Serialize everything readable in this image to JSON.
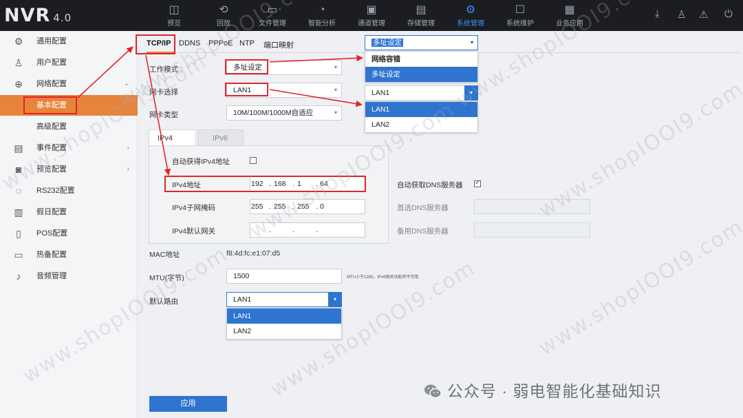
{
  "app": {
    "logo": "NVR",
    "version": "4.0"
  },
  "nav": [
    {
      "label": "预览",
      "icon": "preview-icon"
    },
    {
      "label": "回放",
      "icon": "playback-icon"
    },
    {
      "label": "文件管理",
      "icon": "folder-icon"
    },
    {
      "label": "智能分析",
      "icon": "analysis-icon"
    },
    {
      "label": "通道管理",
      "icon": "channel-icon"
    },
    {
      "label": "存储管理",
      "icon": "storage-icon"
    },
    {
      "label": "系统管理",
      "icon": "gear-icon",
      "active": true
    },
    {
      "label": "系统维护",
      "icon": "maintenance-icon"
    },
    {
      "label": "业务应用",
      "icon": "apps-icon"
    }
  ],
  "sidebar": {
    "items": [
      {
        "label": "通用配置",
        "icon": "gear-icon"
      },
      {
        "label": "用户配置",
        "icon": "user-icon"
      },
      {
        "label": "网络配置",
        "icon": "globe-icon",
        "arrow": "⌄"
      },
      {
        "label": "基本配置",
        "active": true
      },
      {
        "label": "高级配置"
      },
      {
        "label": "事件配置",
        "icon": "event-icon",
        "arrow": "›"
      },
      {
        "label": "预览配置",
        "icon": "camera-icon",
        "arrow": "›"
      },
      {
        "label": "RS232配置",
        "icon": "serial-icon"
      },
      {
        "label": "假日配置",
        "icon": "calendar-icon"
      },
      {
        "label": "POS配置",
        "icon": "pos-icon"
      },
      {
        "label": "热备配置",
        "icon": "hotspare-icon"
      },
      {
        "label": "音频管理",
        "icon": "audio-icon"
      }
    ]
  },
  "tabs": [
    "TCP/IP",
    "DDNS",
    "PPPoE",
    "NTP",
    "端口映射"
  ],
  "form": {
    "work_mode_label": "工作模式",
    "work_mode_value": "多址设定",
    "nic_label": "网卡选择",
    "nic_value": "LAN1",
    "nic_type_label": "网卡类型",
    "nic_type_value": "10M/100M/1000M自适应",
    "subtabs": [
      "IPv4",
      "IPv6"
    ],
    "auto_ipv4_label": "自动获得IPv4地址",
    "ipv4_addr_label": "IPv4地址",
    "ipv4_addr": [
      "192",
      "168",
      "1",
      "64"
    ],
    "ipv4_mask_label": "IPv4子网掩码",
    "ipv4_mask": [
      "255",
      "255",
      "255",
      "0"
    ],
    "ipv4_gw_label": "IPv4默认网关",
    "ipv4_gw": [
      "",
      "",
      "",
      ""
    ],
    "auto_dns_label": "自动获取DNS服务器",
    "auto_dns_checked": true,
    "dns1_label": "首选DNS服务器",
    "dns2_label": "备用DNS服务器",
    "mac_label": "MAC地址",
    "mac_value": "f8:4d:fc:e1:07:d5",
    "mtu_label": "MTU(字节)",
    "mtu_value": "1500",
    "mtu_note": "MTU小于1280，IPv6相关功能将不可用",
    "route_label": "默认路由",
    "route_value": "LAN1",
    "apply_label": "应用"
  },
  "popups": {
    "work_mode": {
      "header": "多址设定",
      "options": [
        "网络容错",
        "多址设定"
      ],
      "selected": 1
    },
    "nic": {
      "header": "LAN1",
      "options": [
        "LAN1",
        "LAN2"
      ],
      "selected": 0
    },
    "route": {
      "options": [
        "LAN1",
        "LAN2"
      ],
      "selected": 0
    }
  },
  "watermark": "www.shopIOOI9.com",
  "wechat_caption": "公众号 · 弱电智能化基础知识",
  "colors": {
    "accent_orange": "#e8833a",
    "accent_blue": "#2f74cf",
    "annotation_red": "#e0262b",
    "topbar": "#1b1d22"
  }
}
